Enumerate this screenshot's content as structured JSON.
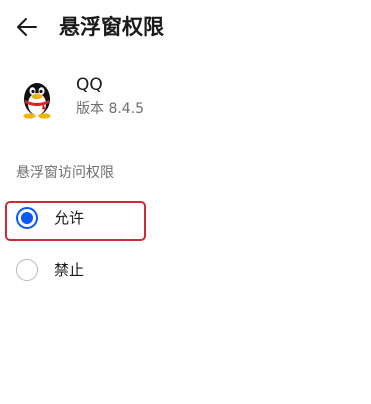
{
  "header": {
    "title": "悬浮窗权限",
    "back_icon": "arrow-left-icon"
  },
  "app": {
    "name": "QQ",
    "version": "版本 8.4.5",
    "icon": "qq-penguin-icon"
  },
  "permission": {
    "section_label": "悬浮窗访问权限",
    "options": [
      {
        "label": "允许",
        "selected": true
      },
      {
        "label": "禁止",
        "selected": false
      }
    ]
  },
  "colors": {
    "accent": "#0a59f7",
    "highlight": "#cc2b3a",
    "secondary_text": "#6e6e6e"
  }
}
